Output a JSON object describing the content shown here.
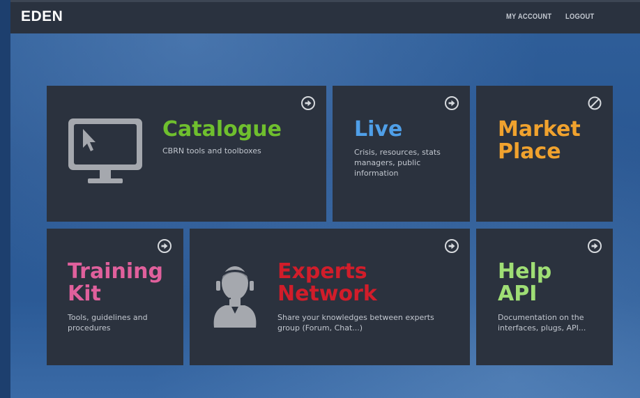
{
  "header": {
    "logo": "EDEN",
    "nav": {
      "my_account": "MY ACCOUNT",
      "logout": "LOGOUT"
    }
  },
  "tiles": [
    {
      "title_lines": [
        "Catalogue"
      ],
      "description": "CBRN tools and toolboxes",
      "color": "#6fbf2e",
      "icon": "arrow-circle-icon",
      "graphic": "monitor-cursor-icon"
    },
    {
      "title_lines": [
        "Live"
      ],
      "description_lines": [
        "Crisis, resources, stats",
        "managers, public",
        "information"
      ],
      "color": "#4f9fe8",
      "icon": "arrow-circle-icon"
    },
    {
      "title_lines": [
        "Market",
        "Place"
      ],
      "description": "",
      "color": "#f0a22e",
      "icon": "disabled-circle-icon"
    },
    {
      "title_lines": [
        "Training",
        "Kit"
      ],
      "description_lines": [
        "Tools, guidelines and",
        "procedures"
      ],
      "color": "#e0609c",
      "icon": "arrow-circle-icon"
    },
    {
      "title_lines": [
        "Experts",
        "Network"
      ],
      "description_lines": [
        "Share your knowledges between experts",
        "group (Forum, Chat...)"
      ],
      "color": "#d11d2a",
      "icon": "arrow-circle-icon",
      "graphic": "headset-operator-icon"
    },
    {
      "title_lines": [
        "Help",
        "API"
      ],
      "description_lines": [
        "Documentation on the",
        "interfaces, plugs, API..."
      ],
      "color": "#9fde75",
      "icon": "arrow-circle-icon"
    }
  ]
}
